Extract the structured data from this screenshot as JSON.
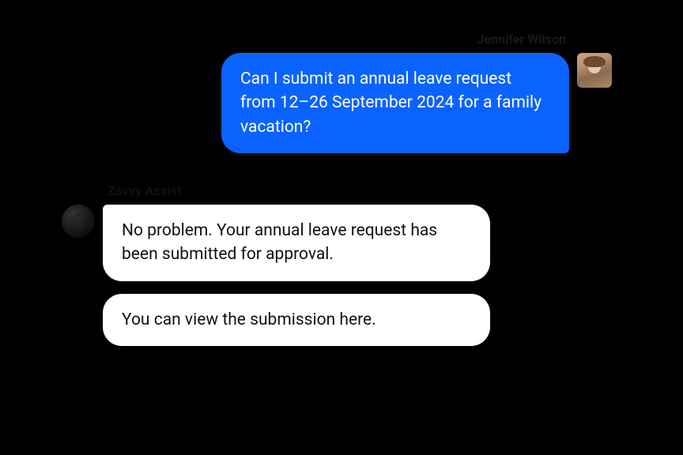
{
  "user": {
    "name": "Jennifer Wilson",
    "message": "Can I submit an annual leave request from 12–26 September 2024 for a family vacation?"
  },
  "bot": {
    "name": "Zavvy Assist",
    "messages": [
      "No problem. Your annual leave request has been submitted for approval.",
      "You can view the submission here."
    ]
  }
}
